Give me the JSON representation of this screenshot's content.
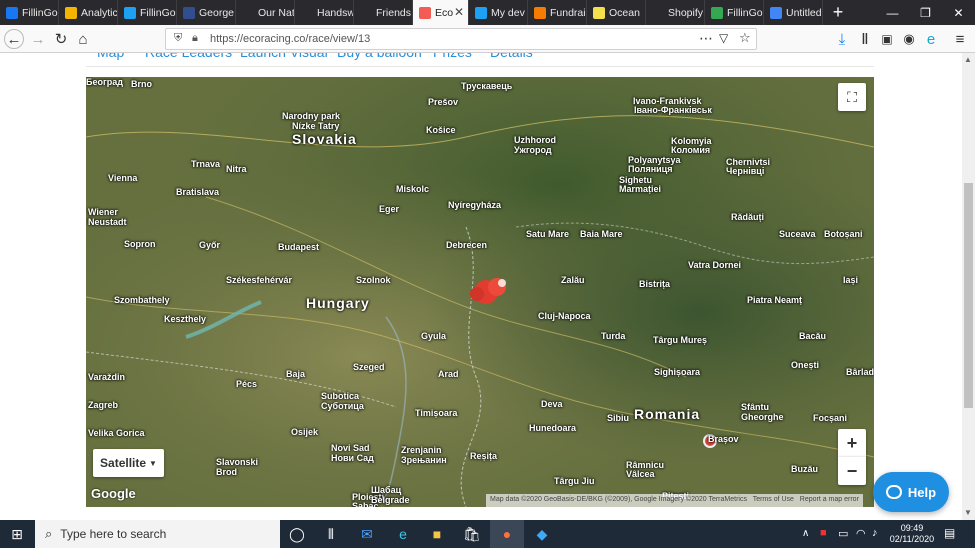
{
  "tabs": [
    {
      "label": "FillinGo",
      "color": "#1877f2"
    },
    {
      "label": "Analytics",
      "color": "#f4b400"
    },
    {
      "label": "FillinGo",
      "color": "#1da1f2"
    },
    {
      "label": "George",
      "color": "#2f4f8f"
    },
    {
      "label": "Our Natural",
      "color": "#2a2a2e"
    },
    {
      "label": "Handsworth",
      "color": "#2a2a2e"
    },
    {
      "label": "Friends of",
      "color": "#2a2a2e"
    },
    {
      "label": "Eco",
      "color": "#f25c54",
      "active": true
    },
    {
      "label": "My dev",
      "color": "#1da1f2"
    },
    {
      "label": "Fundraise",
      "color": "#f57c00"
    },
    {
      "label": "Ocean",
      "color": "#f4e04d"
    },
    {
      "label": "Shopify",
      "color": "#2a2a2e"
    },
    {
      "label": "FillinGo",
      "color": "#34a853"
    },
    {
      "label": "Untitled",
      "color": "#4285f4"
    }
  ],
  "url": "https://ecoracing.co/race/view/13",
  "page_nav": [
    "Map",
    "Race Leaders",
    "Launch Visual",
    "Buy a balloon",
    "Prizes",
    "Details"
  ],
  "map": {
    "type_button": "Satellite",
    "zoom_in": "+",
    "zoom_out": "−",
    "attribution": "Map data ©2020 GeoBasis-DE/BKG (©2009), Google Imagery ©2020 TerraMetrics",
    "terms": "Terms of Use",
    "report": "Report a map error",
    "google": "Google",
    "labels": [
      {
        "t": "Brno"
      },
      {
        "t": "Prešov"
      },
      {
        "t": "Трускавець"
      },
      {
        "t": "Ivano-Frankivsk"
      },
      {
        "t": "Івано-Франківськ"
      },
      {
        "t": "Narodny park"
      },
      {
        "t": "Nízke Tatry"
      },
      {
        "t": "Košice"
      },
      {
        "t": "Slovakia",
        "country": true
      },
      {
        "t": "Uzhhorod"
      },
      {
        "t": "Ужгород"
      },
      {
        "t": "Kolomyia"
      },
      {
        "t": "Коломия"
      },
      {
        "t": "Polyanytsya"
      },
      {
        "t": "Поляниця"
      },
      {
        "t": "Chernivtsi"
      },
      {
        "t": "Чернівці"
      },
      {
        "t": "Trnava"
      },
      {
        "t": "Vienna"
      },
      {
        "t": "Bratislava"
      },
      {
        "t": "Nitra"
      },
      {
        "t": "Miskolc"
      },
      {
        "t": "Wiener"
      },
      {
        "t": "Neustadt"
      },
      {
        "t": "Eger"
      },
      {
        "t": "Nyíregyháza"
      },
      {
        "t": "Sighetu"
      },
      {
        "t": "Marmației"
      },
      {
        "t": "Rădăuți"
      },
      {
        "t": "Sopron"
      },
      {
        "t": "Győr"
      },
      {
        "t": "Budapest"
      },
      {
        "t": "Debrecen"
      },
      {
        "t": "Satu Mare"
      },
      {
        "t": "Baia Mare"
      },
      {
        "t": "Suceava"
      },
      {
        "t": "Botoșani"
      },
      {
        "t": "Szombathely"
      },
      {
        "t": "Székesfehérvár"
      },
      {
        "t": "Szolnok"
      },
      {
        "t": "Vatra Dornei"
      },
      {
        "t": "Hungary",
        "country": true
      },
      {
        "t": "Zalău"
      },
      {
        "t": "Bistrița"
      },
      {
        "t": "Iași"
      },
      {
        "t": "Piatra Neamț"
      },
      {
        "t": "Keszthely"
      },
      {
        "t": "Cluj-Napoca"
      },
      {
        "t": "Gyula"
      },
      {
        "t": "Turda"
      },
      {
        "t": "Târgu Mureș"
      },
      {
        "t": "Bacău"
      },
      {
        "t": "Varaždin"
      },
      {
        "t": "Pécs"
      },
      {
        "t": "Baja"
      },
      {
        "t": "Szeged"
      },
      {
        "t": "Arad"
      },
      {
        "t": "Sighișoara"
      },
      {
        "t": "Onești"
      },
      {
        "t": "Bârlad"
      },
      {
        "t": "Zagreb"
      },
      {
        "t": "Subotica"
      },
      {
        "t": "Суботица"
      },
      {
        "t": "Timișoara"
      },
      {
        "t": "Deva"
      },
      {
        "t": "Romania",
        "country": true
      },
      {
        "t": "Sfântu"
      },
      {
        "t": "Gheorghe"
      },
      {
        "t": "Focșani"
      },
      {
        "t": "Velika Gorica"
      },
      {
        "t": "Osijek"
      },
      {
        "t": "Hunedoara"
      },
      {
        "t": "Sibiu"
      },
      {
        "t": "Brașov"
      },
      {
        "t": "Slavonski"
      },
      {
        "t": "Brod"
      },
      {
        "t": "Novi Sad"
      },
      {
        "t": "Нови Сад"
      },
      {
        "t": "Zrenjanin"
      },
      {
        "t": "Зрењанин"
      },
      {
        "t": "Reșița"
      },
      {
        "t": "Râmnicu"
      },
      {
        "t": "Vâlcea"
      },
      {
        "t": "Buzău"
      },
      {
        "t": "Târgu Jiu"
      },
      {
        "t": "Pitești"
      },
      {
        "t": "Ploiești"
      },
      {
        "t": "Sabac"
      },
      {
        "t": "Шабац"
      },
      {
        "t": "Belgrade"
      },
      {
        "t": "Београд"
      }
    ]
  },
  "help_button": "Help",
  "taskbar": {
    "search_placeholder": "Type here to search",
    "time": "09:49",
    "date": "02/11/2020"
  }
}
